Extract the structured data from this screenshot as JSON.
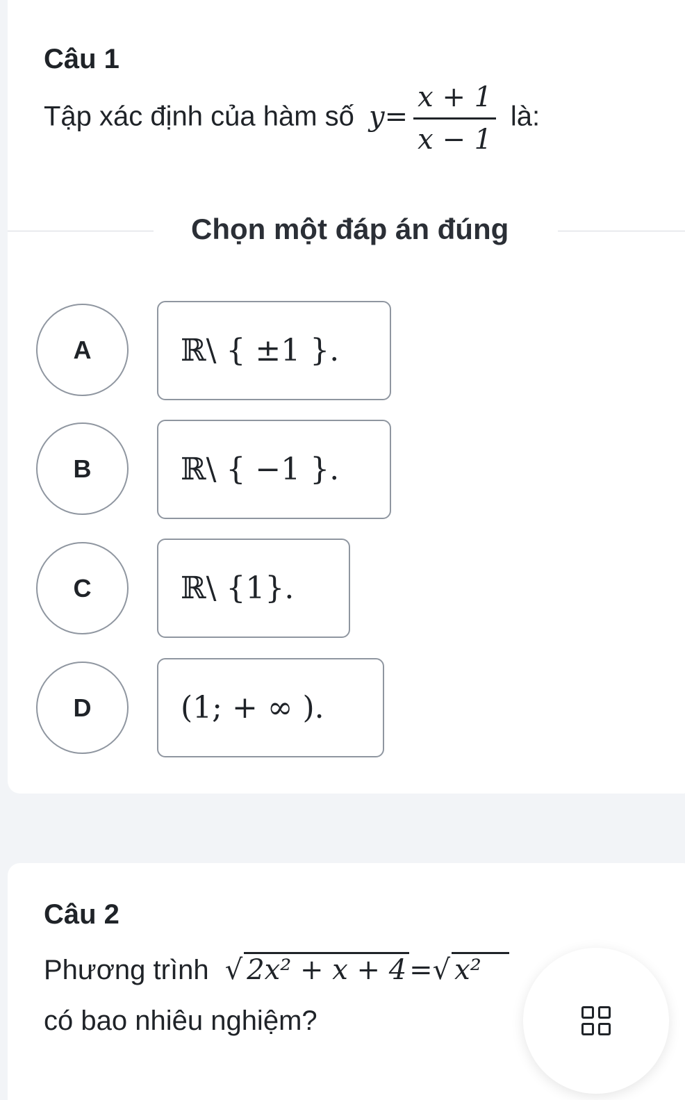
{
  "question1": {
    "title": "Câu 1",
    "prompt_before": "Tập xác định của hàm số",
    "function_lhs": "y",
    "function_eq": "=",
    "numerator": "x + 1",
    "denominator": "x − 1",
    "prompt_after": "là:",
    "divider_label": "Chọn một đáp án đúng",
    "options": [
      {
        "letter": "A",
        "set_symbol": "ℝ",
        "expr": " \\ { ±1 }."
      },
      {
        "letter": "B",
        "set_symbol": "ℝ",
        "expr": " \\ { −1 }."
      },
      {
        "letter": "C",
        "set_symbol": "ℝ",
        "expr": " \\ {1}."
      },
      {
        "letter": "D",
        "set_symbol": "",
        "expr": "(1; + ∞ )."
      }
    ]
  },
  "question2": {
    "title": "Câu 2",
    "prompt_before": "Phương trình",
    "sqrt_left": "2x² + x + 4",
    "equals": "=",
    "sqrt_right_partial": "x²",
    "prompt_line2": "có bao nhiêu nghiệm?"
  },
  "fab": {
    "icon": "grid-icon"
  }
}
